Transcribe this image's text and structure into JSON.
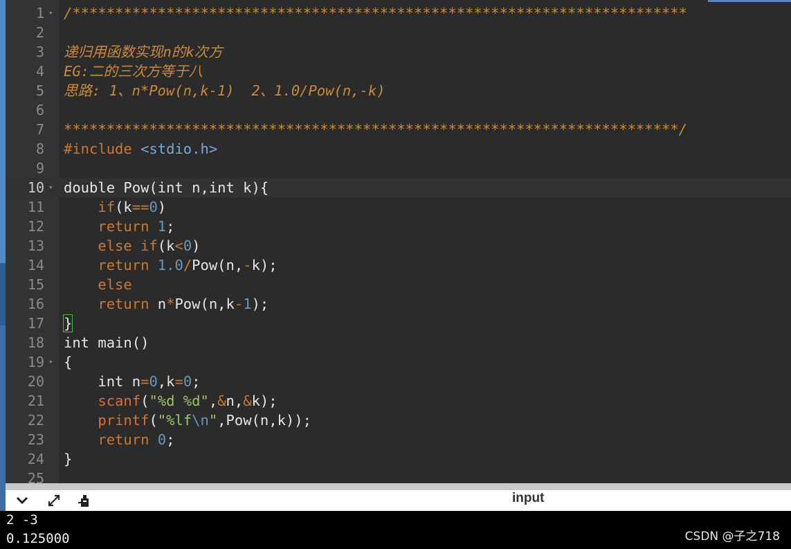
{
  "editor": {
    "current_line": 10,
    "lines": [
      {
        "n": "1",
        "fold": true,
        "parts": [
          [
            "c-com",
            "/************************************************************************"
          ]
        ]
      },
      {
        "n": "2",
        "fold": false,
        "parts": []
      },
      {
        "n": "3",
        "fold": false,
        "parts": [
          [
            "c-com",
            "递归用函数实现n的k次方"
          ]
        ]
      },
      {
        "n": "4",
        "fold": false,
        "parts": [
          [
            "c-com",
            "EG:二的三次方等于八"
          ]
        ]
      },
      {
        "n": "5",
        "fold": false,
        "parts": [
          [
            "c-com",
            "思路: 1、n*Pow(n,k-1)  2、1.0/Pow(n,-k)"
          ]
        ]
      },
      {
        "n": "6",
        "fold": false,
        "parts": []
      },
      {
        "n": "7",
        "fold": false,
        "parts": [
          [
            "c-com",
            "************************************************************************/"
          ]
        ]
      },
      {
        "n": "8",
        "fold": false,
        "parts": [
          [
            "c-pre",
            "#include "
          ],
          [
            "c-inc",
            "<stdio.h>"
          ]
        ]
      },
      {
        "n": "9",
        "fold": false,
        "parts": []
      },
      {
        "n": "10",
        "fold": true,
        "parts": [
          [
            "c-id",
            "double Pow(int n,int k){"
          ]
        ]
      },
      {
        "n": "11",
        "fold": false,
        "parts": [
          [
            "c-id",
            "    "
          ],
          [
            "c-kw",
            "if"
          ],
          [
            "c-id",
            "(k"
          ],
          [
            "c-op",
            "=="
          ],
          [
            "c-num",
            "0"
          ],
          [
            "c-id",
            ")"
          ]
        ]
      },
      {
        "n": "12",
        "fold": false,
        "parts": [
          [
            "c-id",
            "    "
          ],
          [
            "c-kw",
            "return "
          ],
          [
            "c-num",
            "1"
          ],
          [
            "c-id",
            ";"
          ]
        ]
      },
      {
        "n": "13",
        "fold": false,
        "parts": [
          [
            "c-id",
            "    "
          ],
          [
            "c-kw",
            "else if"
          ],
          [
            "c-id",
            "(k"
          ],
          [
            "c-op",
            "<"
          ],
          [
            "c-num",
            "0"
          ],
          [
            "c-id",
            ")"
          ]
        ]
      },
      {
        "n": "14",
        "fold": false,
        "parts": [
          [
            "c-id",
            "    "
          ],
          [
            "c-kw",
            "return "
          ],
          [
            "c-num",
            "1.0"
          ],
          [
            "c-op",
            "/"
          ],
          [
            "c-id",
            "Pow(n,"
          ],
          [
            "c-op",
            "-"
          ],
          [
            "c-id",
            "k);"
          ]
        ]
      },
      {
        "n": "15",
        "fold": false,
        "parts": [
          [
            "c-id",
            "    "
          ],
          [
            "c-kw",
            "else"
          ]
        ]
      },
      {
        "n": "16",
        "fold": false,
        "parts": [
          [
            "c-id",
            "    "
          ],
          [
            "c-kw",
            "return "
          ],
          [
            "c-id",
            "n"
          ],
          [
            "c-op",
            "*"
          ],
          [
            "c-id",
            "Pow(n,k"
          ],
          [
            "c-op",
            "-"
          ],
          [
            "c-num",
            "1"
          ],
          [
            "c-id",
            ");"
          ]
        ]
      },
      {
        "n": "17",
        "fold": false,
        "parts": [
          [
            "bracket-hl",
            "}"
          ]
        ]
      },
      {
        "n": "18",
        "fold": false,
        "parts": [
          [
            "c-id",
            "int main()"
          ]
        ]
      },
      {
        "n": "19",
        "fold": true,
        "parts": [
          [
            "c-id",
            "{"
          ]
        ]
      },
      {
        "n": "20",
        "fold": false,
        "parts": [
          [
            "c-id",
            "    int n"
          ],
          [
            "c-op",
            "="
          ],
          [
            "c-num",
            "0"
          ],
          [
            "c-id",
            ",k"
          ],
          [
            "c-op",
            "="
          ],
          [
            "c-num",
            "0"
          ],
          [
            "c-id",
            ";"
          ]
        ]
      },
      {
        "n": "21",
        "fold": false,
        "parts": [
          [
            "c-id",
            "    "
          ],
          [
            "c-fn",
            "scanf"
          ],
          [
            "c-id",
            "("
          ],
          [
            "c-str",
            "\"%d %d\""
          ],
          [
            "c-id",
            ","
          ],
          [
            "c-op",
            "&"
          ],
          [
            "c-id",
            "n,"
          ],
          [
            "c-op",
            "&"
          ],
          [
            "c-id",
            "k);"
          ]
        ]
      },
      {
        "n": "22",
        "fold": false,
        "parts": [
          [
            "c-id",
            "    "
          ],
          [
            "c-fn",
            "printf"
          ],
          [
            "c-id",
            "("
          ],
          [
            "c-str",
            "\"%lf"
          ],
          [
            "c-esc",
            "\\n"
          ],
          [
            "c-str",
            "\""
          ],
          [
            "c-id",
            ",Pow(n,k));"
          ]
        ]
      },
      {
        "n": "23",
        "fold": false,
        "parts": [
          [
            "c-id",
            "    "
          ],
          [
            "c-kw",
            "return "
          ],
          [
            "c-num",
            "0"
          ],
          [
            "c-id",
            ";"
          ]
        ]
      },
      {
        "n": "24",
        "fold": false,
        "parts": [
          [
            "c-id",
            "}"
          ]
        ]
      },
      {
        "n": "25",
        "fold": false,
        "parts": []
      }
    ]
  },
  "panel": {
    "title": "input",
    "icons": [
      "chevron-down-icon",
      "expand-icon",
      "clear-icon"
    ]
  },
  "console": {
    "lines": [
      "2 -3",
      "0.125000"
    ],
    "watermark": "CSDN @子之718"
  }
}
